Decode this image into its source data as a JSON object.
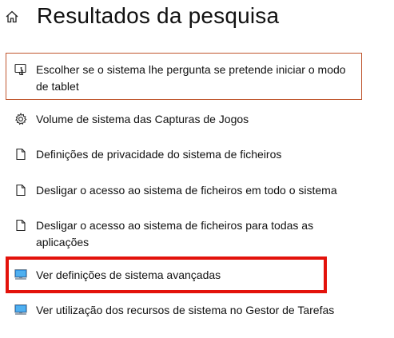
{
  "header": {
    "title": "Resultados da pesquisa",
    "home_icon": "home-icon"
  },
  "results": [
    {
      "label": "Escolher se o sistema lhe pergunta se pretende iniciar o modo de tablet",
      "icon": "tablet-mode-icon",
      "state": "focused"
    },
    {
      "label": "Volume de sistema das Capturas de Jogos",
      "icon": "gear-icon"
    },
    {
      "label": "Definições de privacidade do sistema de ficheiros",
      "icon": "document-icon"
    },
    {
      "label": "Desligar o acesso ao sistema de ficheiros em todo o sistema",
      "icon": "document-icon"
    },
    {
      "label": "Desligar o acesso ao sistema de ficheiros para todas as aplicações",
      "icon": "document-icon"
    },
    {
      "label": "Ver definições de sistema avançadas",
      "icon": "monitor-icon",
      "state": "highlighted"
    },
    {
      "label": "Ver utilização dos recursos de sistema no Gestor de Tarefas",
      "icon": "monitor-icon"
    }
  ],
  "colors": {
    "focus_border": "#c0572f",
    "highlight_annotation": "#e3120b",
    "monitor_blue": "#1e7fd6"
  }
}
